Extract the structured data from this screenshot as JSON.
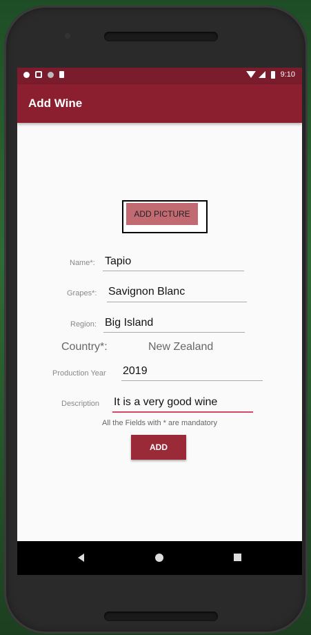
{
  "status_bar": {
    "time": "9:10"
  },
  "app_bar": {
    "title": "Add Wine"
  },
  "form": {
    "add_picture_label": "ADD PICTURE",
    "name": {
      "label": "Name*:",
      "value": "Tapio"
    },
    "grapes": {
      "label": "Grapes*:",
      "value": "Savignon Blanc"
    },
    "region": {
      "label": "Region:",
      "value": "Big Island"
    },
    "country": {
      "label": "Country*:",
      "value": "New Zealand"
    },
    "production_year": {
      "label": "Production Year",
      "value": "2019"
    },
    "description": {
      "label": "Description",
      "value": "It is a very good wine"
    },
    "mandatory_note": "All the Fields with * are mandatory",
    "add_label": "ADD"
  },
  "colors": {
    "primary": "#8b1f30",
    "status_bar": "#7a1c2c",
    "accent": "#d84466",
    "picture_button": "#c26a72"
  }
}
